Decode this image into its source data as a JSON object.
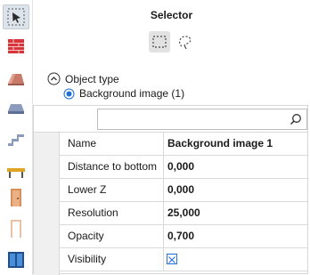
{
  "panel": {
    "title": "Selector",
    "selection_modes": [
      {
        "name": "rectangle-select",
        "active": true
      },
      {
        "name": "lasso-select",
        "active": false
      }
    ]
  },
  "sidebar": {
    "tools": [
      {
        "name": "select-tool",
        "icon": "select-arrow-icon",
        "active": true
      },
      {
        "name": "wall-tool",
        "icon": "brick-wall-icon",
        "active": false
      },
      {
        "name": "roof-tool",
        "icon": "roof-icon",
        "active": false
      },
      {
        "name": "slab-tool",
        "icon": "slab-icon",
        "active": false
      },
      {
        "name": "stair-tool",
        "icon": "stair-icon",
        "active": false
      },
      {
        "name": "beam-tool",
        "icon": "beam-icon",
        "active": false
      },
      {
        "name": "door-tool",
        "icon": "door-icon",
        "active": false
      },
      {
        "name": "opening-tool",
        "icon": "opening-icon",
        "active": false
      },
      {
        "name": "window-tool",
        "icon": "window-icon",
        "active": false
      }
    ]
  },
  "tree": {
    "group_label": "Object type",
    "item_label": "Background image (1)"
  },
  "properties": {
    "search": {
      "value": "",
      "placeholder": ""
    },
    "rows": [
      {
        "name": "Name",
        "value": "Background image 1"
      },
      {
        "name": "Distance to bottom",
        "value": "0,000"
      },
      {
        "name": "Lower Z",
        "value": "0,000"
      },
      {
        "name": "Resolution",
        "value": "25,000"
      },
      {
        "name": "Opacity",
        "value": "0,700"
      },
      {
        "name": "Visibility",
        "checked": true
      }
    ]
  },
  "colors": {
    "accent": "#1f6fd6",
    "wall": "#d9343a",
    "slab": "#7e8fb0",
    "door": "#d98f5a"
  }
}
